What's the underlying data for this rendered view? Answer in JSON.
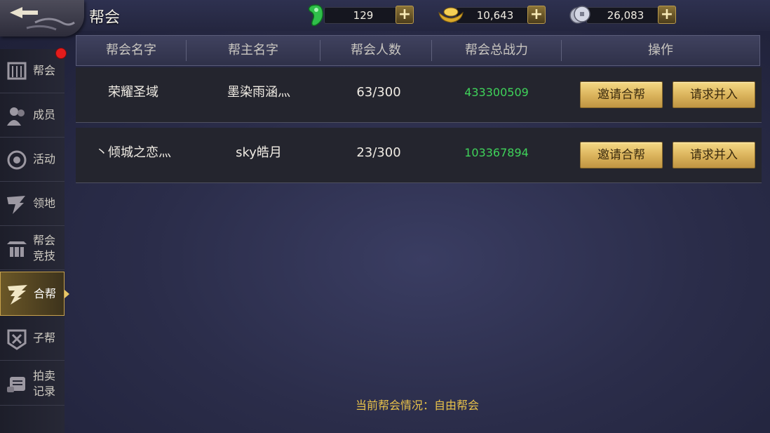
{
  "header": {
    "title": "帮会",
    "resources": [
      {
        "name": "jade",
        "icon": "jade-icon",
        "value": "129"
      },
      {
        "name": "gold",
        "icon": "gold-ingot-icon",
        "value": "10,643"
      },
      {
        "name": "silver",
        "icon": "silver-coin-icon",
        "value": "26,083"
      }
    ],
    "plus_label": "+"
  },
  "sidebar": {
    "items": [
      {
        "label": [
          "帮会"
        ],
        "icon": "guild-banner-icon",
        "active": false
      },
      {
        "label": [
          "成员"
        ],
        "icon": "members-icon",
        "active": false
      },
      {
        "label": [
          "活动"
        ],
        "icon": "activity-icon",
        "active": false
      },
      {
        "label": [
          "领地"
        ],
        "icon": "territory-icon",
        "active": false
      },
      {
        "label": [
          "帮会",
          "竞技"
        ],
        "icon": "arena-icon",
        "active": false
      },
      {
        "label": [
          "合帮"
        ],
        "icon": "merge-wing-icon",
        "active": true
      },
      {
        "label": [
          "子帮"
        ],
        "icon": "sub-guild-icon",
        "active": false
      },
      {
        "label": [
          "拍卖",
          "记录"
        ],
        "icon": "auction-scroll-icon",
        "active": false
      }
    ]
  },
  "table": {
    "columns": [
      "帮会名字",
      "帮主名字",
      "帮会人数",
      "帮会总战力",
      "操作"
    ],
    "rows": [
      {
        "guild": "荣耀圣域",
        "leader": "墨染雨涵灬",
        "members": "63/300",
        "power": "433300509",
        "invite": "邀请合帮",
        "request": "请求并入"
      },
      {
        "guild": "丶倾城之恋灬",
        "leader": "sky皓月",
        "members": "23/300",
        "power": "103367894",
        "invite": "邀请合帮",
        "request": "请求并入"
      }
    ]
  },
  "status": "当前帮会情况：自由帮会",
  "colors": {
    "accent_gold": "#e8c24a",
    "power_green": "#3fd35a",
    "badge_red": "#e31c1c"
  }
}
